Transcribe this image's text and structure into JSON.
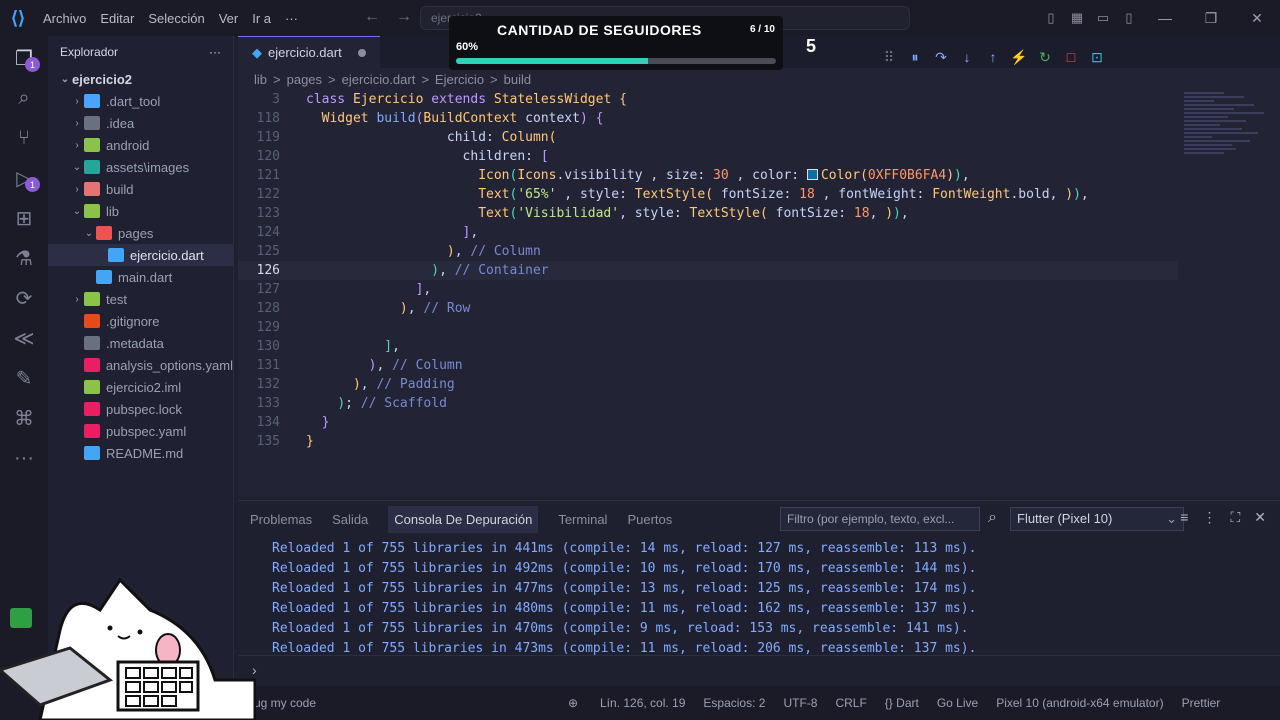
{
  "titlebar": {
    "menu": [
      "Archivo",
      "Editar",
      "Selección",
      "Ver",
      "Ir a",
      "···"
    ],
    "search": "ejercicio2"
  },
  "overlay": {
    "title": "CANTIDAD DE SEGUIDORES",
    "count": "6 / 10",
    "percent_label": "60%",
    "progress": 0.6,
    "side_number": "5"
  },
  "sidebar": {
    "title": "Explorador",
    "more": "···",
    "root": "ejercicio2",
    "items": [
      {
        "label": ".dart_tool",
        "indent": 1,
        "chev": "›",
        "color": "#4aa3ff"
      },
      {
        "label": ".idea",
        "indent": 1,
        "chev": "›",
        "color": "#6b7080"
      },
      {
        "label": "android",
        "indent": 1,
        "chev": "›",
        "color": "#8bc34a"
      },
      {
        "label": "assets\\images",
        "indent": 1,
        "chev": "⌄",
        "color": "#26a69a"
      },
      {
        "label": "build",
        "indent": 1,
        "chev": "›",
        "color": "#e57373"
      },
      {
        "label": "lib",
        "indent": 1,
        "chev": "⌄",
        "color": "#8bc34a"
      },
      {
        "label": "pages",
        "indent": 2,
        "chev": "⌄",
        "color": "#ef5350"
      },
      {
        "label": "ejercicio.dart",
        "indent": 3,
        "chev": "",
        "color": "#42a5f5",
        "selected": true
      },
      {
        "label": "main.dart",
        "indent": 2,
        "chev": "",
        "color": "#42a5f5"
      },
      {
        "label": "test",
        "indent": 1,
        "chev": "›",
        "color": "#8bc34a"
      },
      {
        "label": ".gitignore",
        "indent": 1,
        "chev": "",
        "color": "#e64a19"
      },
      {
        "label": ".metadata",
        "indent": 1,
        "chev": "",
        "color": "#6b7080"
      },
      {
        "label": "analysis_options.yaml",
        "indent": 1,
        "chev": "",
        "color": "#e91e63"
      },
      {
        "label": "ejercicio2.iml",
        "indent": 1,
        "chev": "",
        "color": "#8bc34a"
      },
      {
        "label": "pubspec.lock",
        "indent": 1,
        "chev": "",
        "color": "#e91e63"
      },
      {
        "label": "pubspec.yaml",
        "indent": 1,
        "chev": "",
        "color": "#e91e63"
      },
      {
        "label": "README.md",
        "indent": 1,
        "chev": "",
        "color": "#42a5f5"
      }
    ]
  },
  "editor": {
    "tab": "ejercicio.dart",
    "breadcrumbs": [
      "lib",
      ">",
      "pages",
      ">",
      "ejercicio.dart",
      ">",
      "Ejercicio",
      ">",
      "build"
    ],
    "line_numbers": [
      "3",
      "118",
      "119",
      "120",
      "121",
      "122",
      "123",
      "124",
      "125",
      "126",
      "127",
      "128",
      "129",
      "130",
      "131",
      "132",
      "133",
      "134",
      "135"
    ],
    "current_line": "126"
  },
  "panel": {
    "tabs": [
      "Problemas",
      "Salida",
      "Consola De Depuración",
      "Terminal",
      "Puertos"
    ],
    "filter_placeholder": "Filtro (por ejemplo, texto, excl...",
    "device": "Flutter (Pixel 10)",
    "logs": [
      "Reloaded 1 of 755 libraries in 441ms (compile: 14 ms, reload: 127 ms, reassemble: 113 ms).",
      "Reloaded 1 of 755 libraries in 492ms (compile: 10 ms, reload: 170 ms, reassemble: 144 ms).",
      "Reloaded 1 of 755 libraries in 477ms (compile: 13 ms, reload: 125 ms, reassemble: 174 ms).",
      "Reloaded 1 of 755 libraries in 480ms (compile: 11 ms, reload: 162 ms, reassemble: 137 ms).",
      "Reloaded 1 of 755 libraries in 470ms (compile: 9 ms, reload: 153 ms, reassemble: 141 ms).",
      "Reloaded 1 of 755 libraries in 473ms (compile: 11 ms, reload: 206 ms, reassemble: 137 ms)."
    ],
    "prompt": "›"
  },
  "statusbar": {
    "left": "ug my code",
    "items": [
      "Lín. 126, col. 19",
      "Espacios: 2",
      "UTF-8",
      "CRLF",
      "{} Dart",
      "Go Live",
      "Pixel 10 (android-x64 emulator)",
      "Prettier"
    ]
  }
}
